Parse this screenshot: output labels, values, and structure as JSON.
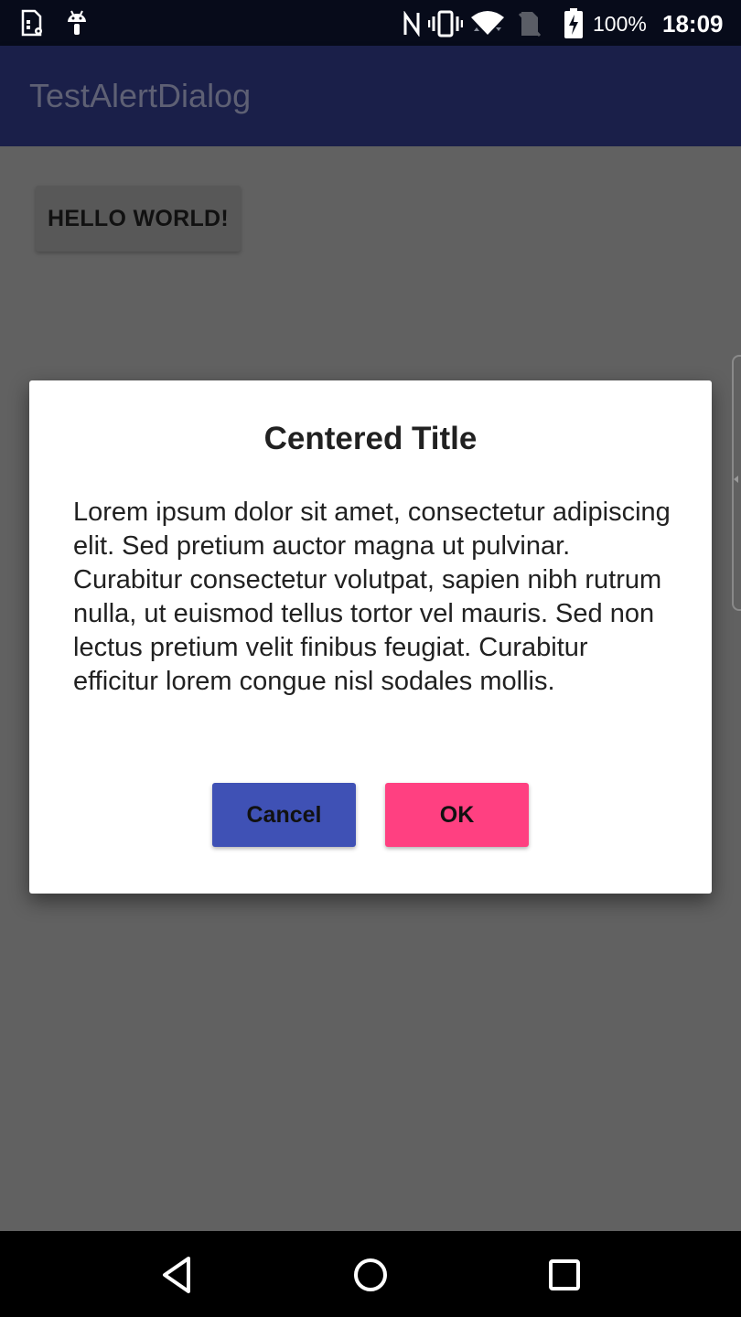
{
  "status_bar": {
    "icons": [
      "sim-settings-icon",
      "android-icon",
      "nfc-icon",
      "vibrate-icon",
      "wifi-icon",
      "no-sim-icon",
      "battery-charging-icon"
    ],
    "battery_percent": "100%",
    "time": "18:09"
  },
  "app_bar": {
    "title": "TestAlertDialog"
  },
  "content": {
    "hello_button_label": "HELLO WORLD!"
  },
  "dialog": {
    "title": "Centered Title",
    "message": "Lorem ipsum dolor sit amet, consectetur adipiscing elit. Sed pretium auctor magna ut pulvinar. Curabitur consectetur volutpat, sapien nibh rutrum nulla, ut euismod tellus tortor vel mauris. Sed non lectus pretium velit finibus feugiat. Curabitur efficitur lorem congue nisl sodales mollis.",
    "cancel_label": "Cancel",
    "ok_label": "OK"
  },
  "nav_bar": {
    "buttons": [
      "back-icon",
      "home-icon",
      "recents-icon"
    ]
  },
  "colors": {
    "status_bar": "#070b1a",
    "app_bar": "#1a1f49",
    "scrim_background": "#616161",
    "cancel_button": "#3f51b5",
    "ok_button": "#ff4081",
    "dialog_background": "#ffffff"
  }
}
